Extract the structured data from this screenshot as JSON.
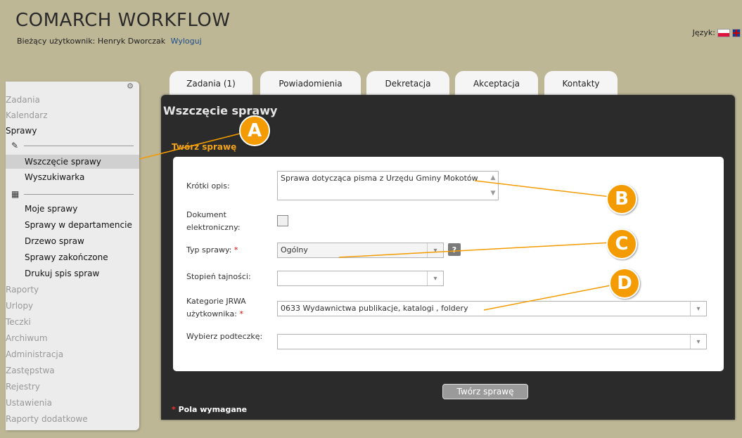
{
  "header": {
    "brand": "COMARCH WORKFLOW",
    "user_label": "Bieżący użytkownik: Henryk Dworczak",
    "logout": "Wyloguj",
    "lang_label": "Język:"
  },
  "sidebar": {
    "items": [
      {
        "label": "Zadania"
      },
      {
        "label": "Kalendarz"
      },
      {
        "label": "Sprawy"
      },
      {
        "label": "Wszczęcie sprawy"
      },
      {
        "label": "Wyszukiwarka"
      },
      {
        "label": "Moje sprawy"
      },
      {
        "label": "Sprawy w departamencie"
      },
      {
        "label": "Drzewo spraw"
      },
      {
        "label": "Sprawy zakończone"
      },
      {
        "label": "Drukuj spis spraw"
      },
      {
        "label": "Raporty"
      },
      {
        "label": "Urlopy"
      },
      {
        "label": "Teczki"
      },
      {
        "label": "Archiwum"
      },
      {
        "label": "Administracja"
      },
      {
        "label": "Zastępstwa"
      },
      {
        "label": "Rejestry"
      },
      {
        "label": "Ustawienia"
      },
      {
        "label": "Raporty dodatkowe"
      }
    ]
  },
  "tabs": [
    {
      "label": "Zadania (1)"
    },
    {
      "label": "Powiadomienia"
    },
    {
      "label": "Dekretacja"
    },
    {
      "label": "Akceptacja"
    },
    {
      "label": "Kontakty"
    }
  ],
  "panel": {
    "title": "Wszczęcie sprawy",
    "section": "Twórz sprawę"
  },
  "form": {
    "short_desc_label": "Krótki opis:",
    "short_desc_value": "Sprawa dotycząca pisma z Urzędu Gminy Mokotów",
    "edoc_label": "Dokument elektroniczny:",
    "case_type_label": "Typ sprawy:",
    "case_type_value": "Ogólny",
    "secrecy_label": "Stopień tajności:",
    "secrecy_value": "",
    "jrwa_label": "Kategorie JRWA użytkownika:",
    "jrwa_value": "0633 Wydawnictwa publikacje, katalogi , foldery",
    "subfolder_label": "Wybierz podteczkę:",
    "subfolder_value": "",
    "help_glyph": "?",
    "required_star": "*"
  },
  "actions": {
    "submit": "Twórz sprawę",
    "required_note": "Pola wymagane"
  },
  "callouts": [
    "A",
    "B",
    "C",
    "D"
  ],
  "colors": {
    "accent": "#f39b00",
    "background": "#bdb796",
    "panel": "#2b2b2b"
  }
}
